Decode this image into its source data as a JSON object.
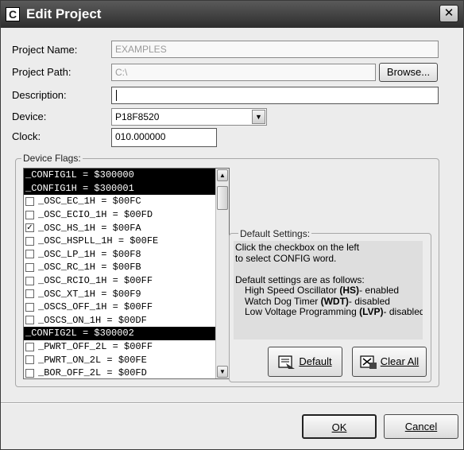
{
  "window": {
    "title": "Edit Project",
    "app_icon_letter": "C",
    "close_symbol": "✕"
  },
  "form": {
    "project_name_label": "Project Name:",
    "project_name_value": "EXAMPLES",
    "project_path_label": "Project Path:",
    "project_path_value": "C:\\",
    "browse_label": "Browse...",
    "description_label": "Description:",
    "description_value": "",
    "device_label": "Device:",
    "device_value": "P18F8520",
    "clock_label": "Clock:",
    "clock_value": "010.000000"
  },
  "device_flags": {
    "group_title": "Device Flags:",
    "rows": [
      {
        "text": "_CONFIG1L = $300000",
        "header": true
      },
      {
        "text": "_CONFIG1H = $300001",
        "header": true
      },
      {
        "text": "_OSC_EC_1H = $00FC",
        "checked": false
      },
      {
        "text": "_OSC_ECIO_1H = $00FD",
        "checked": false
      },
      {
        "text": "_OSC_HS_1H = $00FA",
        "checked": true
      },
      {
        "text": "_OSC_HSPLL_1H = $00FE",
        "checked": false
      },
      {
        "text": "_OSC_LP_1H = $00F8",
        "checked": false
      },
      {
        "text": "_OSC_RC_1H = $00FB",
        "checked": false
      },
      {
        "text": "_OSC_RCIO_1H = $00FF",
        "checked": false
      },
      {
        "text": "_OSC_XT_1H = $00F9",
        "checked": false
      },
      {
        "text": "_OSCS_OFF_1H = $00FF",
        "checked": false
      },
      {
        "text": "_OSCS_ON_1H = $00DF",
        "checked": false
      },
      {
        "text": "_CONFIG2L = $300002",
        "header": true
      },
      {
        "text": "_PWRT_OFF_2L = $00FF",
        "checked": false
      },
      {
        "text": "_PWRT_ON_2L = $00FE",
        "checked": false
      },
      {
        "text": "_BOR_OFF_2L = $00FD",
        "checked": false
      }
    ]
  },
  "default_settings": {
    "group_title": "Default Settings:",
    "lines": [
      "Click the checkbox on the left",
      "to select CONFIG word.",
      "",
      "Default settings are as follows:"
    ],
    "bullets": [
      {
        "before": "High Speed Oscillator ",
        "bold": "(HS)",
        "after": "- enabled"
      },
      {
        "before": "Watch Dog Timer ",
        "bold": "(WDT)",
        "after": "- disabled"
      },
      {
        "before": "Low Voltage Programming ",
        "bold": "(LVP)",
        "after": "- disabled"
      }
    ],
    "default_button": "Default",
    "clear_all_button": "Clear All"
  },
  "footer": {
    "ok_label": "OK",
    "cancel_label": "Cancel"
  }
}
